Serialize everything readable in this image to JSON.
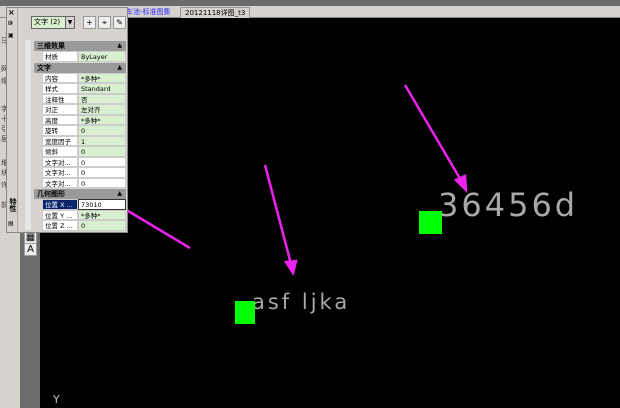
{
  "tabs": [
    {
      "label": "车池-标准图集"
    },
    {
      "label": "20121118详图_t3"
    }
  ],
  "left_strip": [
    "马",
    "网",
    "缘",
    "字",
    "十",
    "引",
    "层",
    "堆",
    "块",
    "许",
    "前"
  ],
  "palette": {
    "title": "特性",
    "selector": "文字 (2)",
    "sections": [
      {
        "title": "三维效果",
        "rows": [
          {
            "k": "材质",
            "v": "ByLayer"
          }
        ]
      },
      {
        "title": "文字",
        "rows": [
          {
            "k": "内容",
            "v": "*多种*"
          },
          {
            "k": "样式",
            "v": "Standard"
          },
          {
            "k": "注释性",
            "v": "否"
          },
          {
            "k": "对正",
            "v": "左对齐"
          },
          {
            "k": "高度",
            "v": "*多种*"
          },
          {
            "k": "旋转",
            "v": "0"
          },
          {
            "k": "宽度因子",
            "v": "1"
          },
          {
            "k": "倾斜",
            "v": "0"
          },
          {
            "k": "文字对...",
            "v": "0"
          },
          {
            "k": "文字对...",
            "v": "0"
          },
          {
            "k": "文字对...",
            "v": "0"
          }
        ]
      },
      {
        "title": "几何图形",
        "rows": [
          {
            "k": "位置 X ...",
            "v": "73010"
          },
          {
            "k": "位置 Y ...",
            "v": "*多种*"
          },
          {
            "k": "位置 Z ...",
            "v": "0"
          }
        ]
      }
    ]
  },
  "canvas": {
    "text1": "36456d",
    "text2": "asf ljka",
    "ucs_label": "Y"
  },
  "colors": {
    "grip": "#00ff00",
    "arrow": "#ee22ee"
  }
}
